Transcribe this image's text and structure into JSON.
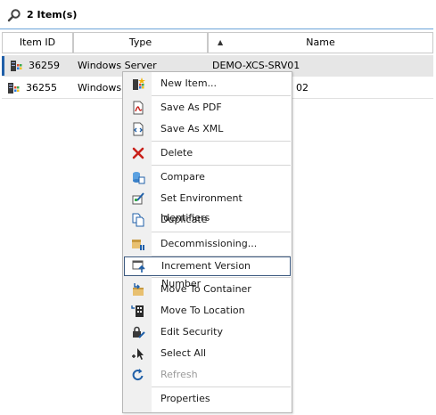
{
  "header": {
    "item_count": "2 Item(s)",
    "icon": "search-icon"
  },
  "grid": {
    "columns": [
      "Item ID",
      "Type",
      "Name"
    ],
    "sort_indicator": "▲",
    "rows": [
      {
        "id": "36259",
        "type": "Windows Server",
        "name": "DEMO-XCS-SRV01",
        "selected": true
      },
      {
        "id": "36255",
        "type": "Windows",
        "name": "02",
        "selected": false
      }
    ]
  },
  "menu": {
    "items": [
      {
        "label": "New Item...",
        "icon": "new-item-icon"
      },
      {
        "label": "Save As PDF",
        "icon": "pdf-icon"
      },
      {
        "label": "Save As XML",
        "icon": "xml-icon"
      },
      {
        "label": "Delete",
        "icon": "delete-icon"
      },
      {
        "label": "Compare",
        "icon": "compare-icon"
      },
      {
        "label": "Set Environment Identifiers",
        "icon": "environment-icon"
      },
      {
        "label": "Duplicate",
        "icon": "duplicate-icon"
      },
      {
        "label": "Decommissioning...",
        "icon": "decommission-icon"
      },
      {
        "label": "Increment Version Number",
        "icon": "increment-version-icon",
        "highlighted": true
      },
      {
        "label": "Move To Container",
        "icon": "move-container-icon"
      },
      {
        "label": "Move To Location",
        "icon": "move-location-icon"
      },
      {
        "label": "Edit Security",
        "icon": "security-icon"
      },
      {
        "label": "Select All",
        "icon": "select-all-icon"
      },
      {
        "label": "Refresh",
        "icon": "refresh-icon",
        "disabled": true
      },
      {
        "label": "Properties",
        "icon": ""
      }
    ]
  },
  "colors": {
    "accent": "#1f5fa8",
    "selection": "#e6e6e6",
    "menu_gutter": "#f0f0f0"
  }
}
